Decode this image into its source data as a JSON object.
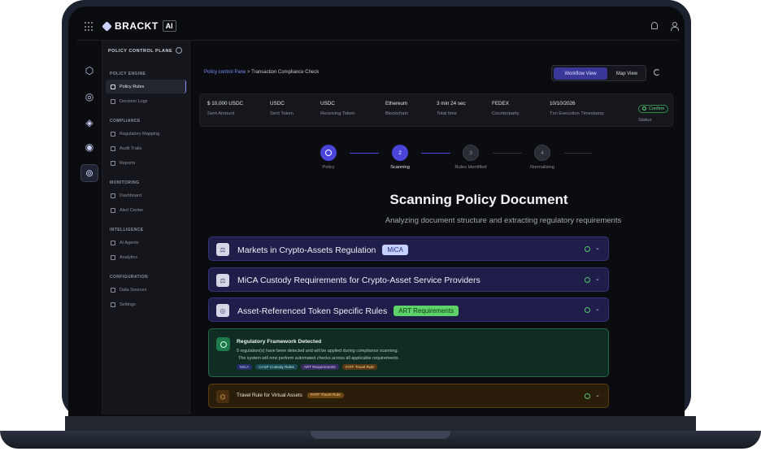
{
  "brand": {
    "name": "BRACKT",
    "badge": "AI"
  },
  "sidenav": {
    "title": "POLICY CONTROL PLANE",
    "sections": [
      {
        "title": "POLICY ENGINE",
        "items": [
          {
            "label": "Policy Rules",
            "active": true
          },
          {
            "label": "Decision Logs"
          }
        ]
      },
      {
        "title": "COMPLIANCE",
        "items": [
          {
            "label": "Regulatory Mapping"
          },
          {
            "label": "Audit Trails"
          },
          {
            "label": "Reports"
          }
        ]
      },
      {
        "title": "MONITORING",
        "items": [
          {
            "label": "Dashboard"
          },
          {
            "label": "Alert Center"
          }
        ]
      },
      {
        "title": "INTELLIGENCE",
        "items": [
          {
            "label": "AI Agents"
          },
          {
            "label": "Analytics"
          }
        ]
      },
      {
        "title": "CONFIGURATION",
        "items": [
          {
            "label": "Data Sources"
          },
          {
            "label": "Settings"
          }
        ]
      }
    ]
  },
  "breadcrumb": {
    "link": "Policy control Pane",
    "separator": ">",
    "current": "Transaction Compliance Check"
  },
  "view_toggle": {
    "workflow": "Workflow View",
    "map": "Map View",
    "selected": "Workflow View"
  },
  "transaction": [
    {
      "value": "$ 10,000 USDC",
      "label": "Sent Amount"
    },
    {
      "value": "USDC",
      "label": "Sent Token"
    },
    {
      "value": "USDC",
      "label": "Receiving Token"
    },
    {
      "value": "Ethereum",
      "label": "Blockchain"
    },
    {
      "value": "3 min 24 sec",
      "label": "Total time"
    },
    {
      "value": "FEDEX",
      "label": "Counterparty"
    },
    {
      "value": "10/10/2026",
      "label": "Txn Execution Timestamp"
    },
    {
      "value": "Confirm",
      "label": "Status"
    }
  ],
  "stepper": [
    {
      "number": "1",
      "label": "Policy",
      "state": "done"
    },
    {
      "number": "2",
      "label": "Scanning",
      "state": "current"
    },
    {
      "number": "3",
      "label": "Rules Identified",
      "state": "todo"
    },
    {
      "number": "4",
      "label": "Normalising",
      "state": "todo"
    }
  ],
  "scan": {
    "title": "Scanning Policy Document",
    "subtitle": "Analyzing document structure and extracting regulatory requirements"
  },
  "frameworks": [
    {
      "title": "Markets in Crypto-Assets Regulation",
      "tag": "MiCA",
      "icon": "scale-icon"
    },
    {
      "title": "MiCA Custody Requirements for Crypto-Asset Service Providers",
      "tag": "",
      "icon": "scale-icon"
    },
    {
      "title": "Asset-Referenced Token Specific Rules",
      "tag": "ART Requirements",
      "icon": "coins-icon"
    }
  ],
  "detected": {
    "title": "Regulatory Framework Detected",
    "line1": "5 regulation(s) have been detected and will be applied during compliance scanning.",
    "line2": "The system will now perform automated checks across all applicable requirements.",
    "tags": [
      "MiCA",
      "CASP Custody Rules",
      "ART Requirements",
      "FATF Travel Rule"
    ]
  },
  "travel_rule": {
    "title": "Travel Rule for Virtual Assets",
    "tag": "FATF Travel Rule"
  },
  "colors": {
    "accent": "#4a44d8",
    "success": "#5fdc7d",
    "warning": "#f2b14b"
  }
}
